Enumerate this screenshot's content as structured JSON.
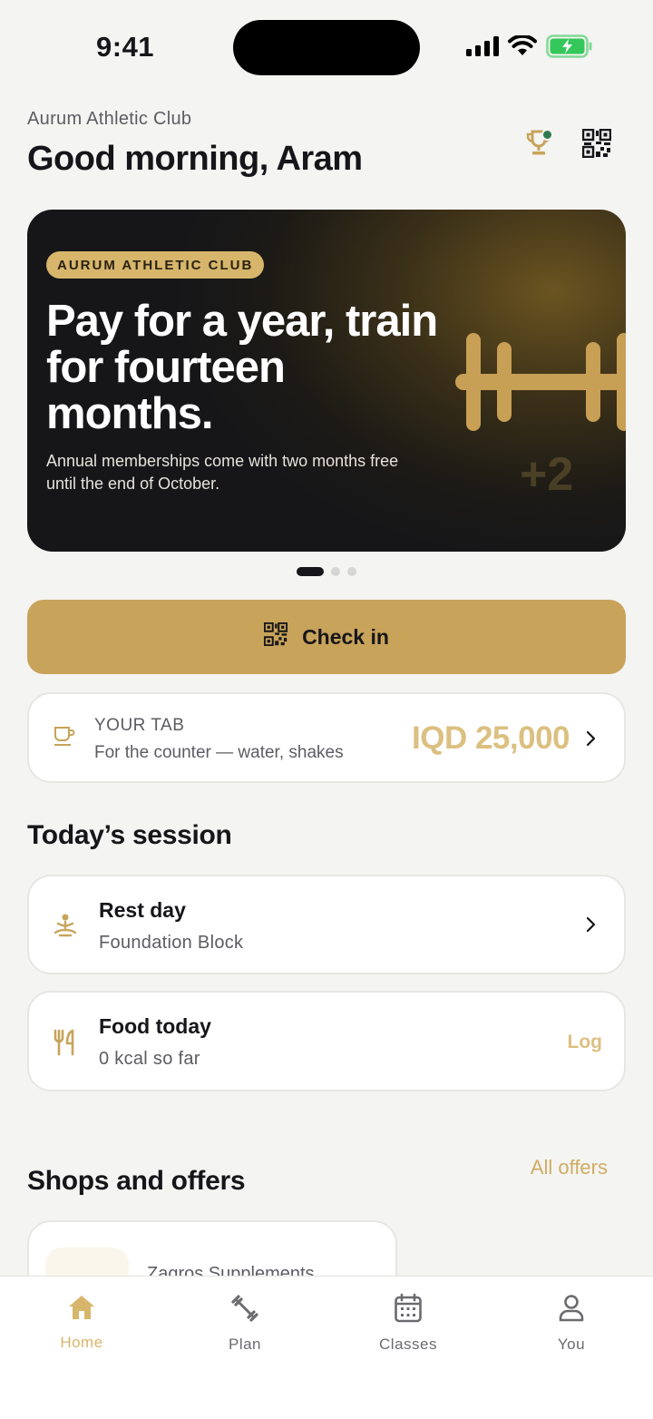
{
  "status": {
    "time": "9:41"
  },
  "header": {
    "club_name": "Aurum Athletic Club",
    "greeting": "Good morning, Aram"
  },
  "promo": {
    "tag": "AURUM ATHLETIC CLUB",
    "title": "Pay for a year, train for fourteen months.",
    "subtitle": "Annual memberships come with two months free until the end of October.",
    "art_badge": "+2",
    "page_count": 3,
    "active_page": 1
  },
  "checkin": {
    "label": "Check in"
  },
  "tab": {
    "label": "YOUR TAB",
    "description": "For the counter — water, shakes",
    "amount": "IQD 25,000"
  },
  "session": {
    "section_title": "Today’s session",
    "rest": {
      "title": "Rest day",
      "subtitle": "Foundation Block"
    },
    "food": {
      "title": "Food today",
      "subtitle": "0 kcal so far",
      "action": "Log"
    }
  },
  "offers": {
    "section_title": "Shops and offers",
    "link": "All offers",
    "shops": [
      {
        "name": "Zagros Supplements"
      }
    ]
  },
  "tabbar": {
    "items": [
      {
        "label": "Home",
        "icon": "home-icon",
        "active": true
      },
      {
        "label": "Plan",
        "icon": "dumbbell-icon",
        "active": false
      },
      {
        "label": "Classes",
        "icon": "calendar-icon",
        "active": false
      },
      {
        "label": "You",
        "icon": "person-icon",
        "active": false
      }
    ]
  },
  "colors": {
    "accent": "#c8a35a",
    "accent_light": "#dcc081",
    "background": "#f4f4f2",
    "notification": "#2d7a4f",
    "battery": "#34c759"
  }
}
